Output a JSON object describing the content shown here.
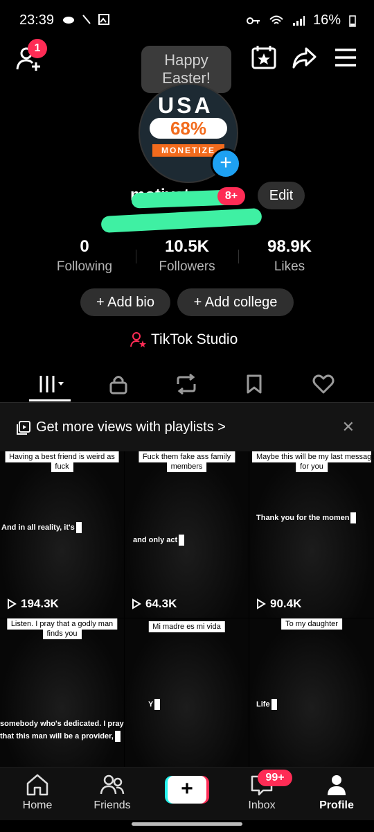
{
  "status": {
    "time": "23:39",
    "battery": "16%"
  },
  "header": {
    "notif_count": "1",
    "easter": "Happy Easter!"
  },
  "avatar": {
    "line1": "USA",
    "line2": "68%",
    "line3": "MONETIZE"
  },
  "profile": {
    "username": "motivaton",
    "username_badge": "8+",
    "edit_label": "Edit"
  },
  "stats": [
    {
      "value": "0",
      "label": "Following"
    },
    {
      "value": "10.5K",
      "label": "Followers"
    },
    {
      "value": "98.9K",
      "label": "Likes"
    }
  ],
  "pills": {
    "bio": "+ Add bio",
    "college": "+ Add college"
  },
  "studio": "TikTok Studio",
  "banner": "Get more views with playlists >",
  "videos": [
    {
      "top": "Having a best friend is weird as",
      "top2": "fuck",
      "mid": "And in all reality, it's",
      "views": "194.3K"
    },
    {
      "top": "Fuck them fake ass family",
      "top2": "members",
      "mid": "and only act",
      "views": "64.3K"
    },
    {
      "top": "Maybe this will be my last message",
      "top2": "for you",
      "mid": "Thank you for the momen",
      "views": "90.4K"
    },
    {
      "top": "Listen. I pray that a godly man",
      "top2": "finds you",
      "mid": "somebody who's dedicated. I pray",
      "mid2": "that this man will be a provider,",
      "views": ""
    },
    {
      "top": "Mi madre es mi vida",
      "top2": "",
      "mid": "Y",
      "views": ""
    },
    {
      "top": "To my daughter",
      "top2": "",
      "mid": "Life",
      "views": ""
    }
  ],
  "nav": {
    "home": "Home",
    "friends": "Friends",
    "inbox": "Inbox",
    "inbox_badge": "99+",
    "profile": "Profile"
  },
  "colors": {
    "accent": "#fe2c55",
    "highlight": "#3ff0a3",
    "blue": "#1ea1f2"
  }
}
